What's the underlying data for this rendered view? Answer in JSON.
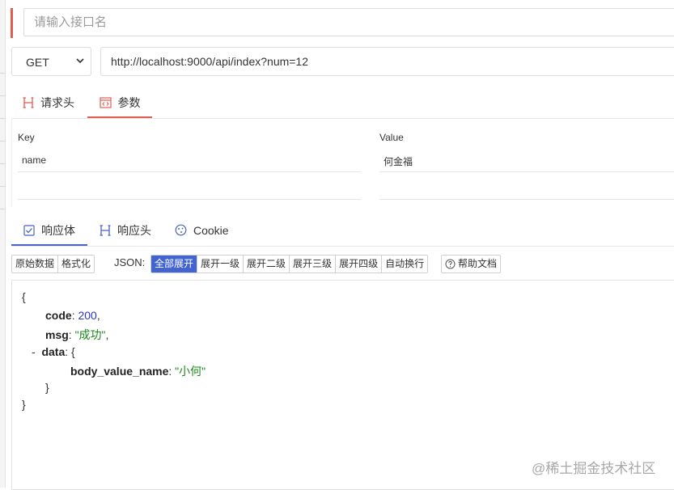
{
  "api_name": {
    "placeholder": "请输入接口名"
  },
  "request": {
    "method": "GET",
    "url": "http://localhost:9000/api/index?num=12",
    "tabs": [
      {
        "label": "请求头",
        "icon": "h-heading-icon"
      },
      {
        "label": "参数",
        "icon": "code-window-icon",
        "active": true
      }
    ]
  },
  "params": {
    "key_header": "Key",
    "value_header": "Value",
    "rows": [
      {
        "key": "name",
        "value": "何金福"
      },
      {
        "key": "",
        "value": ""
      }
    ]
  },
  "response": {
    "tabs": [
      {
        "label": "响应体",
        "icon": "checkbox-icon",
        "active": true
      },
      {
        "label": "响应头",
        "icon": "h-heading-icon"
      },
      {
        "label": "Cookie",
        "icon": "cookie-icon"
      }
    ],
    "view_buttons": [
      "原始数据",
      "格式化"
    ],
    "json_label": "JSON:",
    "expand_buttons": [
      "全部展开",
      "展开一级",
      "展开二级",
      "展开三级",
      "展开四级",
      "自动换行"
    ],
    "active_expand": "全部展开",
    "help_label": "帮助文档",
    "json": {
      "open_brace": "{",
      "code_key": "code",
      "code_value": "200",
      "msg_key": "msg",
      "msg_value": "\"成功\"",
      "collapse_toggle": "-",
      "data_key": "data",
      "body_key": "body_value_name",
      "body_value": "\"小何\"",
      "inner_close": "}",
      "close_brace": "}"
    }
  },
  "watermark": "@稀土掘金技术社区",
  "colors": {
    "accent_red": "#e15d4f",
    "accent_blue": "#4264d0",
    "json_number": "#2b35c6",
    "json_string": "#1a8a1a"
  }
}
